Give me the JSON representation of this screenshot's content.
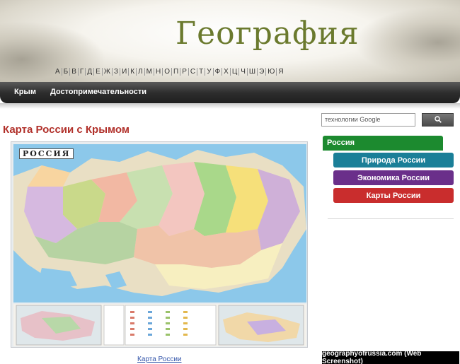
{
  "site": {
    "title": "География",
    "alphabet": [
      "А",
      "Б",
      "В",
      "Г",
      "Д",
      "Е",
      "Ж",
      "З",
      "И",
      "К",
      "Л",
      "М",
      "Н",
      "О",
      "П",
      "Р",
      "С",
      "Т",
      "У",
      "Ф",
      "Х",
      "Ц",
      "Ч",
      "Ш",
      "Э",
      "Ю",
      "Я"
    ]
  },
  "nav": {
    "items": [
      {
        "label": "Крым"
      },
      {
        "label": "Достопримечательности"
      }
    ]
  },
  "main": {
    "heading": "Карта России с Крымом",
    "map": {
      "badge": "РОССИЯ",
      "caption": "Карта России"
    }
  },
  "sidebar": {
    "search": {
      "placeholder": "технологии Google",
      "button_icon": "search-icon"
    },
    "parent_item": {
      "label": "Россия",
      "color": "#1c8a2f"
    },
    "items": [
      {
        "label": "Природа России",
        "color": "#1a7f98"
      },
      {
        "label": "Экономика России",
        "color": "#6a2f8a"
      },
      {
        "label": "Карты России",
        "color": "#c92d2d"
      }
    ]
  },
  "watermark": "geographyofrussia.com (Web Screenshot)"
}
